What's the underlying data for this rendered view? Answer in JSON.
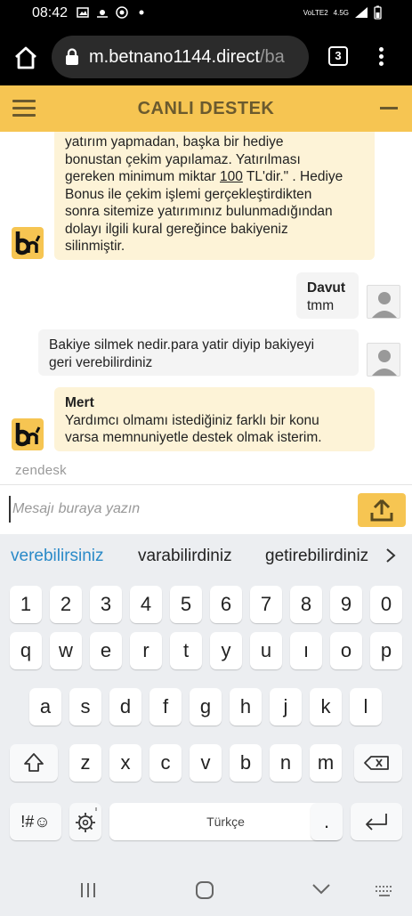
{
  "status_bar": {
    "time": "08:42",
    "right_labels": [
      "VoLTE2",
      "4.5G"
    ]
  },
  "browser": {
    "url_main": "m.betnano1144.direct",
    "url_rest": "/ba",
    "tab_count": "3"
  },
  "chat": {
    "title": "CANLI DESTEK",
    "messages": [
      {
        "sender": "agent",
        "name": "",
        "lines": [
          "yatırım yapmadan, başka bir hediye",
          "bonustan çekim yapılamaz. Yatırılması",
          "gereken minimum miktar ",
          "100",
          " TL'dir.\" . Hediye",
          "Bonus ile çekim işlemi gerçekleştirdikten",
          "sonra sitemize yatırımınız bulunmadığından",
          "dolayı ilgili kural gereğince bakiyeniz",
          "silinmiştir."
        ]
      },
      {
        "sender": "user",
        "name": "Davut",
        "text": "tmm"
      },
      {
        "sender": "user",
        "name": "",
        "text1": "Bakiye silmek nedir.para yatir diyip bakiyeyi",
        "text2": "geri verebilirdiniz"
      },
      {
        "sender": "agent",
        "name": "Mert",
        "text1": "Yardımcı olmamı istediğiniz farklı bir konu",
        "text2": "varsa memnuniyetle destek olmak isterim."
      }
    ],
    "powered_by": "zendesk",
    "input_placeholder": "Mesajı buraya yazın"
  },
  "keyboard": {
    "suggestions": [
      "verebilirsiniz",
      "varabilirdiniz",
      "getirebilirdiniz"
    ],
    "row_numbers": [
      "1",
      "2",
      "3",
      "4",
      "5",
      "6",
      "7",
      "8",
      "9",
      "0"
    ],
    "row1": [
      "q",
      "w",
      "e",
      "r",
      "t",
      "y",
      "u",
      "ı",
      "o",
      "p"
    ],
    "row2": [
      "a",
      "s",
      "d",
      "f",
      "g",
      "h",
      "j",
      "k",
      "l"
    ],
    "row3": [
      "z",
      "x",
      "c",
      "v",
      "b",
      "n",
      "m"
    ],
    "symbols_label": "!#☺",
    "space_label": "Türkçe",
    "period_label": "."
  },
  "colors": {
    "accent": "#f6c552",
    "header_text": "#6b5a2e",
    "agent_bubble": "#fdf3d7",
    "suggestion_highlight": "#2a8ac8"
  }
}
